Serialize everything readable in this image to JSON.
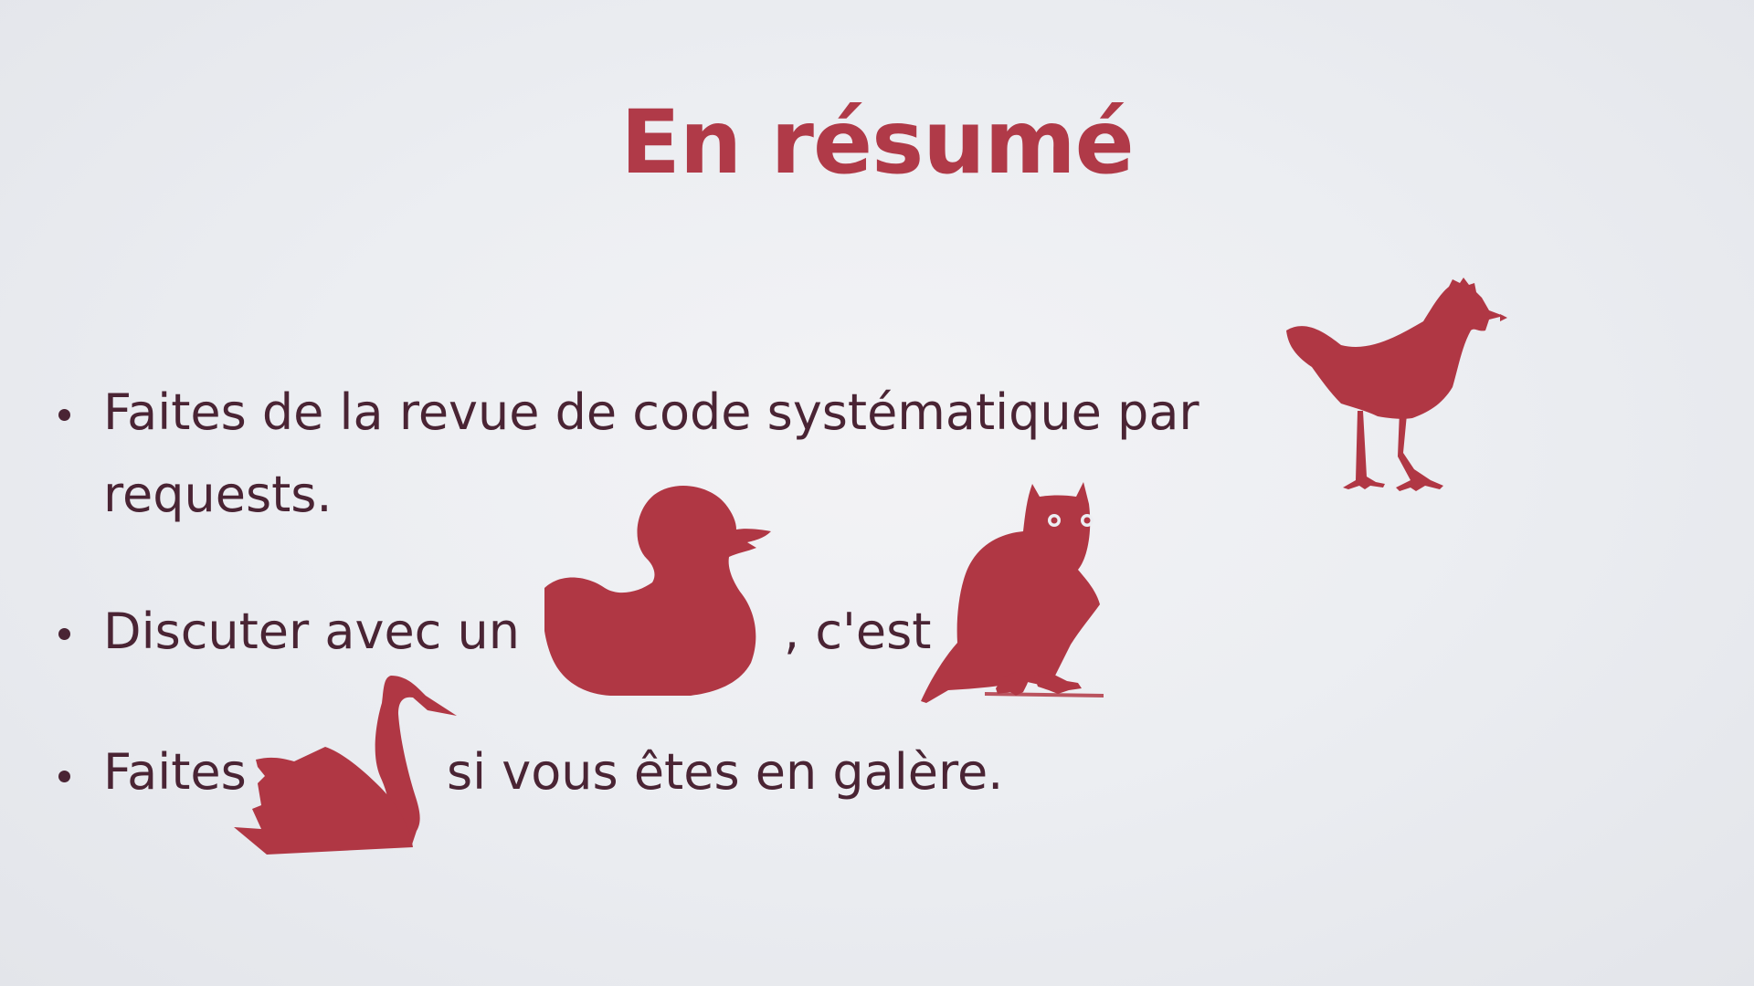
{
  "slide": {
    "title": "En résumé",
    "bullets": [
      {
        "line1": "Faites de la revue de code systématique par",
        "line2": "requests.",
        "icon": "chicken-icon"
      },
      {
        "before": "Discuter avec un",
        "icon_1": "duck-icon",
        "after": ", c'est",
        "icon_2": "owl-icon"
      },
      {
        "before": "Faites",
        "icon": "swan-icon",
        "after": "si vous êtes en galère."
      }
    ]
  },
  "colors": {
    "accent": "#b03a48",
    "animal": "#b03744",
    "text": "#4a2434",
    "background": "#eceef2"
  }
}
